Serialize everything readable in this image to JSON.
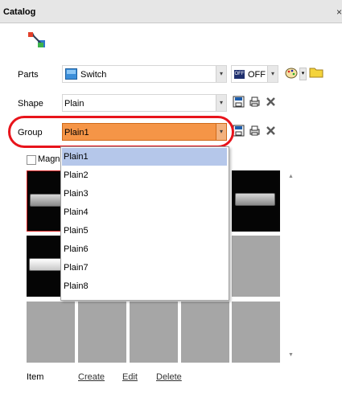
{
  "window": {
    "title": "Catalog",
    "close_glyph": "×"
  },
  "toolbar": {
    "icon": "catalog-tool-icon"
  },
  "parts": {
    "label": "Parts",
    "value": "Switch",
    "state_value": "OFF",
    "state_badge": "OFF"
  },
  "shape": {
    "label": "Shape",
    "value": "Plain"
  },
  "group": {
    "label": "Group",
    "value": "Plain1",
    "options": [
      "Plain1",
      "Plain2",
      "Plain3",
      "Plain4",
      "Plain5",
      "Plain6",
      "Plain7",
      "Plain8"
    ],
    "selected_index": 0
  },
  "magnify": {
    "label": "Magni"
  },
  "footer": {
    "item_label": "Item",
    "create": "Create",
    "edit": "Edit",
    "delete": "Delete"
  },
  "colors": {
    "accent_orange": "#f59547",
    "highlight_red": "#e8141b",
    "selection_blue": "#b5c7ea"
  }
}
